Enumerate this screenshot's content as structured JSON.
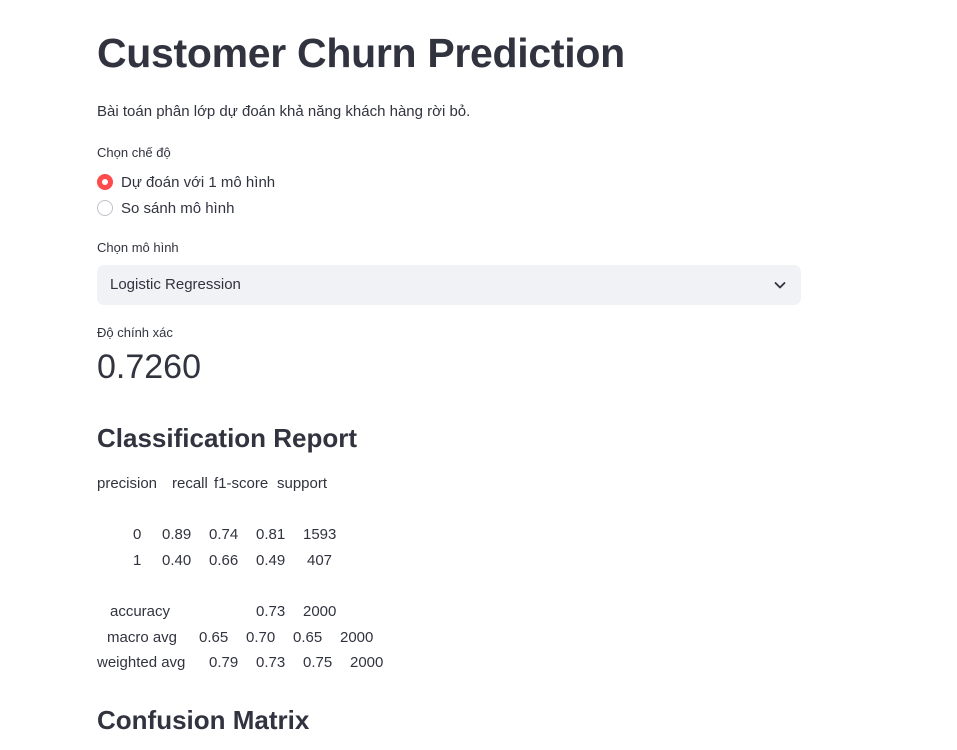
{
  "page": {
    "title": "Customer Churn Prediction",
    "caption": "Bài toán phân lớp dự đoán khả năng khách hàng rời bỏ."
  },
  "mode": {
    "label": "Chọn chế độ",
    "options": [
      {
        "label": "Dự đoán với 1 mô hình",
        "selected": true
      },
      {
        "label": "So sánh mô hình",
        "selected": false
      }
    ]
  },
  "model_select": {
    "label": "Chọn mô hình",
    "value": "Logistic Regression",
    "icon": "chevron-down-icon"
  },
  "metric": {
    "label": "Độ chính xác",
    "value": "0.7260"
  },
  "report": {
    "heading": "Classification Report",
    "headers": [
      "precision",
      "recall",
      "f1-score",
      "support"
    ],
    "rows": [
      {
        "label": "0",
        "values": [
          "0.89",
          "0.74",
          "0.81",
          "1593"
        ]
      },
      {
        "label": "1",
        "values": [
          "0.40",
          "0.66",
          "0.49",
          "407"
        ]
      }
    ],
    "accuracy": {
      "label": "accuracy",
      "values": [
        "0.73",
        "2000"
      ]
    },
    "macro": {
      "label": "macro avg",
      "values": [
        "0.65",
        "0.70",
        "0.65",
        "2000"
      ]
    },
    "weighted": {
      "label": "weighted avg",
      "values": [
        "0.79",
        "0.73",
        "0.75",
        "2000"
      ]
    }
  },
  "confusion": {
    "heading": "Confusion Matrix"
  },
  "colors": {
    "accent": "#FF4B4B",
    "text": "#31333F",
    "select_bg": "#F0F2F6"
  }
}
